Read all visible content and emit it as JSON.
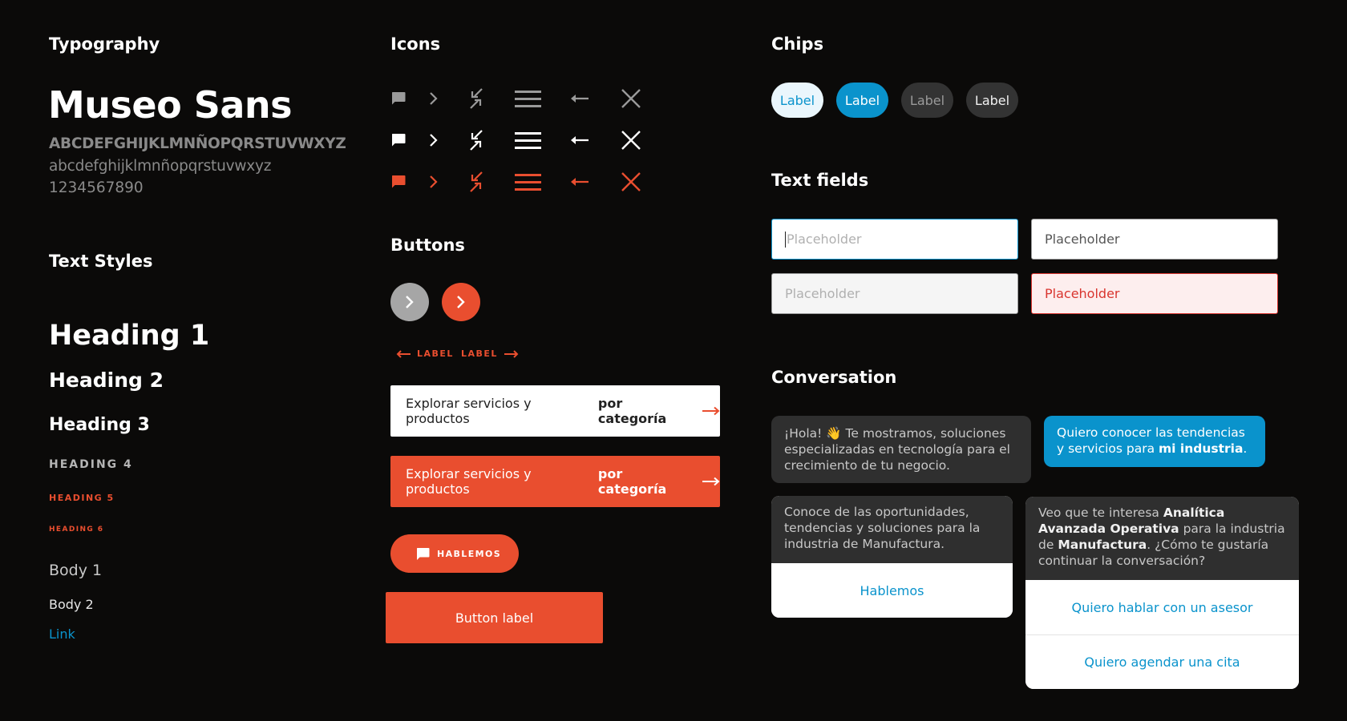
{
  "colors": {
    "background": "#0b0a09",
    "accent_orange": "#e94e2f",
    "accent_blue": "#0a93cc",
    "gray": "#9a9a9a",
    "white": "#ffffff",
    "bubble_dark": "#2f2f2f"
  },
  "typography": {
    "title": "Typography",
    "font_name": "Museo Sans",
    "uppercase": "ABCDEFGHIJKLMNÑOPQRSTUVWXYZ",
    "lowercase": "abcdefghijklmnñopqrstuvwxyz",
    "numbers": "1234567890"
  },
  "text_styles": {
    "title": "Text Styles",
    "heading1": "Heading 1",
    "heading2": "Heading 2",
    "heading3": "Heading 3",
    "heading4": "HEADING 4",
    "heading5": "HEADING 5",
    "heading6": "HEADING 6",
    "body1": "Body 1",
    "body2": "Body 2",
    "link": "Link"
  },
  "icons": {
    "title": "Icons",
    "rows": [
      {
        "state": "default",
        "color": "#9a9a9a"
      },
      {
        "state": "active",
        "color": "#ffffff"
      },
      {
        "state": "accent",
        "color": "#e94e2f"
      }
    ],
    "set": [
      "chat-icon",
      "chevron-right-icon",
      "compress-icon",
      "menu-icon",
      "arrow-left-icon",
      "close-icon"
    ]
  },
  "buttons": {
    "title": "Buttons",
    "back_label": "LABEL",
    "next_label": "LABEL",
    "cta_text": "Explorar servicios y productos",
    "cta_bold": "por categoría",
    "pill_label": "HABLEMOS",
    "main_label": "Button label"
  },
  "chips": {
    "title": "Chips",
    "items": [
      {
        "label": "Label",
        "state": "light"
      },
      {
        "label": "Label",
        "state": "selected"
      },
      {
        "label": "Label",
        "state": "disabled"
      },
      {
        "label": "Label",
        "state": "default"
      }
    ]
  },
  "text_fields": {
    "title": "Text fields",
    "focused_placeholder": "Placeholder",
    "filled_value": "Placeholder",
    "disabled_placeholder": "Placeholder",
    "error_value": "Placeholder"
  },
  "conversation": {
    "title": "Conversation",
    "greeting": {
      "prefix": "¡Hola! ",
      "emoji": "👋",
      "text": " Te mostramos, soluciones especializadas en tecnología para el crecimiento de tu negocio."
    },
    "user_message": {
      "text": "Quiero conocer las tendencias y servicios para ",
      "bold": "mi industria",
      "suffix": "."
    },
    "card1": {
      "text": "Conoce de las oportunidades, tendencias y soluciones para la industria de Manufactura.",
      "option": "Hablemos"
    },
    "card2": {
      "t1": "Veo que te interesa ",
      "b1": "Analítica Avanzada Operativa",
      "t2": " para la industria de ",
      "b2": "Manufactura",
      "t3": ". ¿Cómo te gustaría continuar la conversación?",
      "options": [
        "Quiero hablar con un asesor",
        "Quiero agendar una cita"
      ]
    }
  }
}
